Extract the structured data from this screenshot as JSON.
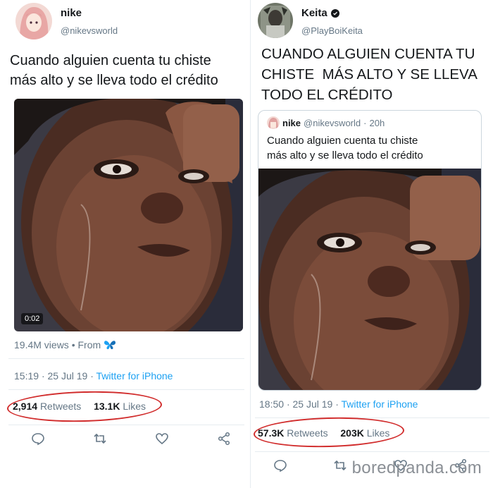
{
  "left_tweet": {
    "display_name": "nike",
    "handle": "@nikevsworld",
    "text_line1": "Cuando alguien cuenta tu chiste",
    "text_line2": "más alto y se lleva todo el crédito",
    "video_duration": "0:02",
    "views": "19.4M views",
    "views_from": "From",
    "from_icon": "butterfly-icon",
    "time": "15:19",
    "date": "25 Jul 19",
    "source": "Twitter for iPhone",
    "retweets_count": "2,914",
    "retweets_label": "Retweets",
    "likes_count": "13.1K",
    "likes_label": "Likes"
  },
  "right_tweet": {
    "display_name": "Keita",
    "handle": "@PlayBoiKeita",
    "text_line1": "CUANDO ALGUIEN CUENTA TU",
    "text_line2": "CHISTE  MÁS ALTO Y SE LLEVA",
    "text_line3": "TODO EL CRÉDITO",
    "quoted": {
      "display_name": "nike",
      "handle": "@nikevsworld",
      "time": "20h",
      "text_line1": "Cuando alguien cuenta tu chiste",
      "text_line2": "más alto y se lleva todo el crédito"
    },
    "time": "18:50",
    "date": "25 Jul 19",
    "source": "Twitter for iPhone",
    "retweets_count": "57.3K",
    "retweets_label": "Retweets",
    "likes_count": "203K",
    "likes_label": "Likes"
  },
  "separators": {
    "dot": "·"
  },
  "watermark": "boredpanda.com",
  "colors": {
    "accent": "#1da1f2",
    "annotation_circle": "#d12c2c",
    "secondary_text": "#657786"
  }
}
